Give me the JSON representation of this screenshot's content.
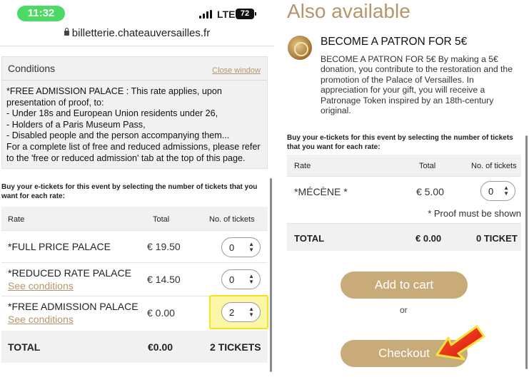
{
  "status_bar": {
    "time": "11:32",
    "network": "LTE",
    "battery": "72"
  },
  "browser": {
    "url": "billetterie.chateauversailles.fr"
  },
  "conditions": {
    "title": "Conditions",
    "close_label": "Close window",
    "lines": [
      "*FREE ADMISSION PALACE : This rate applies, upon",
      "presentation of proof, to:",
      "- Under 18s and European Union residents under 26,",
      "- Holders of a Paris Museum Pass,",
      "- Disabled people and the person accompanying them...",
      "For a complete list of free and reduced admissions, please refer",
      "to the 'free or reduced admission' tab at the top of this page."
    ]
  },
  "left_tickets": {
    "intro": "Buy your e-tickets for this event by selecting the number of tickets that you want for each rate:",
    "headers": {
      "rate": "Rate",
      "total": "Total",
      "count": "No. of tickets"
    },
    "rows": [
      {
        "name": "*FULL PRICE PALACE",
        "link": "",
        "price": "€ 19.50",
        "qty": "0"
      },
      {
        "name": "*REDUCED RATE PALACE",
        "link": "See conditions",
        "price": "€ 14.50",
        "qty": "0"
      },
      {
        "name": "*FREE ADMISSION PALACE",
        "link": "See conditions",
        "price": "€ 0.00",
        "qty": "2"
      }
    ],
    "total": {
      "label": "TOTAL",
      "amount": "€0.00",
      "tickets": "2 TICKETS"
    }
  },
  "also_available": {
    "heading": "Also available",
    "product_title": "BECOME A PATRON FOR 5€",
    "product_desc_lines": [
      "BECOME A PATRON FOR 5€ By making a 5€",
      "donation, you contribute to the restoration and the",
      "promotion of the Palace of Versailles. In",
      "appreciation for your gift, you will receive a",
      "Patronage Token inspired by an 18th-century",
      "original."
    ]
  },
  "right_tickets": {
    "intro": "Buy your e-tickets for this event by selecting the number of tickets that you want for each rate:",
    "headers": {
      "rate": "Rate",
      "total": "Total",
      "count": "No. of tickets"
    },
    "row": {
      "name": "*MÉCÈNE *",
      "price": "€ 5.00",
      "qty": "0"
    },
    "proof_note": "* Proof must be shown",
    "total": {
      "label": "TOTAL",
      "amount": "€ 0.00",
      "tickets": "0 TICKET"
    }
  },
  "actions": {
    "add_to_cart": "Add to cart",
    "or": "or",
    "checkout": "Checkout"
  },
  "colors": {
    "gold": "#b4966a",
    "button": "#c8ab78",
    "highlight": "#f4e31c",
    "arrow": "#e8190c",
    "time_pill": "#4cd964"
  }
}
